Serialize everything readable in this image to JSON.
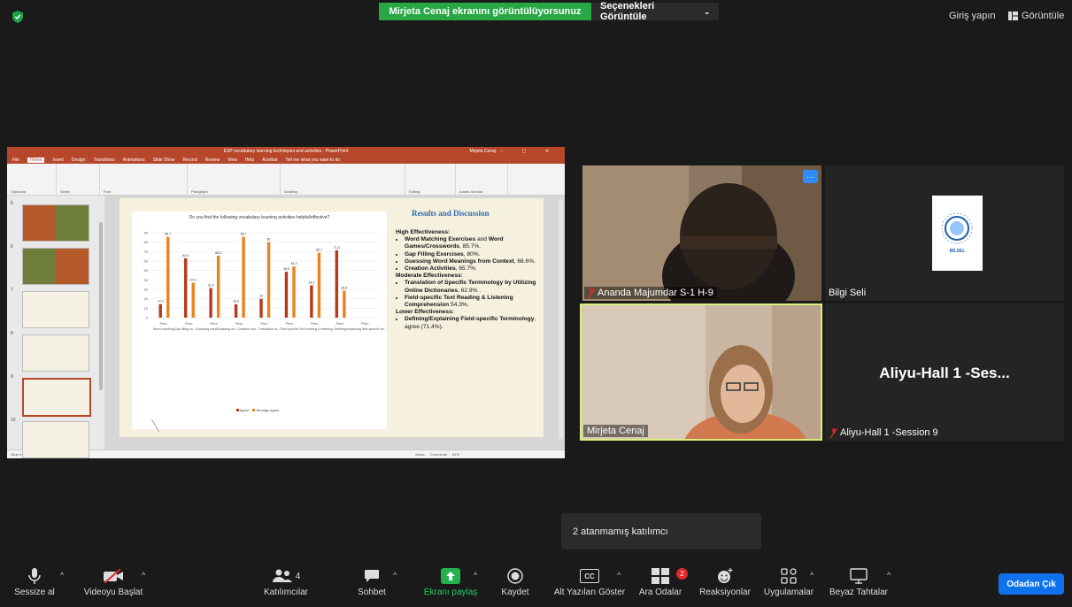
{
  "banner": {
    "sharing_text": "Mirjeta Cenaj ekranını görüntülüyorsunuz",
    "view_options": "Seçenekleri Görüntüle"
  },
  "top_right": {
    "sign_in": "Giriş yapın",
    "view": "Görüntüle"
  },
  "ppt": {
    "title": "ESP vocabulary learning techniques and activities - PowerPoint",
    "user": "Mirjeta Cenaj",
    "tabs": [
      "File",
      "Home",
      "Insert",
      "Design",
      "Transitions",
      "Animations",
      "Slide Show",
      "Record",
      "Review",
      "View",
      "Help",
      "Acrobat",
      "Tell me what you want to do"
    ],
    "ribbon_groups": [
      "Clipboard",
      "Slides",
      "Font",
      "Paragraph",
      "Drawing",
      "Editing",
      "Adobe Acrobat"
    ],
    "thumb_numbers": [
      "5",
      "6",
      "7",
      "8",
      "9",
      "10"
    ],
    "status": [
      "Slide 9 of 11",
      "Accessibility: Investigate",
      "Notes",
      "Comments",
      "61%"
    ]
  },
  "slide": {
    "results_title": "Results and Discussion",
    "high_heading": "High Effectiveness:",
    "high_items": [
      {
        "bold": "Word Matching Exercises",
        "mid": " and ",
        "bold2": "Word Games/Crosswords",
        "rest": ", 85.7%."
      },
      {
        "bold": "Gap Filling Exercises",
        "rest": ", 80%."
      },
      {
        "bold": "Guessing Word Meanings from Context",
        "rest": ", 68.6%."
      },
      {
        "bold": "Creation Activities",
        "rest": ", 65.7%."
      }
    ],
    "moderate_heading": "Moderate Effectiveness:",
    "moderate_items": [
      {
        "bold": "Translation of Specific Terminology by Utilizing Online Dictionaries",
        "rest": ", 62.9% ."
      },
      {
        "bold": "Field-specific Text Reading & Listening Comprehension",
        "rest": " 54.3%."
      }
    ],
    "lower_heading": "Lower Effectiveness:",
    "lower_items": [
      {
        "bold": "Defining/Explaining Field-specific Terminology",
        "rest": ", agree (71.4%)."
      }
    ]
  },
  "chart_data": {
    "type": "bar",
    "title": "Do you find the following vocabulary learning activities helpful/effective?",
    "categories": [
      "Perc.",
      "Perc.",
      "Perc.",
      "Perc.",
      "Perc.",
      "Perc.",
      "Perc.",
      "Perc.",
      "Perc."
    ],
    "ylim": [
      0,
      90
    ],
    "yticks": [
      0,
      10,
      20,
      30,
      40,
      50,
      60,
      70,
      80,
      90
    ],
    "series": [
      {
        "name": "Agree",
        "color": "#b53a1b",
        "values": [
          14.3,
          62.9,
          31.4,
          14.3,
          20,
          48.6,
          34.3,
          71.4,
          null
        ]
      },
      {
        "name": "Strongly agree",
        "color": "#e8841c",
        "values": [
          85.7,
          37.1,
          65.7,
          85.7,
          80,
          54.3,
          68.7,
          28.6,
          null
        ]
      }
    ],
    "data_labels": [
      [
        "14.3",
        "62.9",
        "31.4",
        "14.3",
        "20",
        "48.6",
        "34.3",
        "71.4"
      ],
      [
        "85.7",
        "37.1",
        "65.6",
        "85.7",
        "80",
        "54.3",
        "68.7",
        "28.6"
      ]
    ],
    "category_text_overlap": "Word matchingGap filling ex...Guessing wordGuessing wo...Creation acti...Translation of...Field-specific Text reading & listening..Defining/explaining field-specific ter..."
  },
  "participants": [
    {
      "name": "Ananda Majumdar S-1 H-9",
      "muted": true
    },
    {
      "name": "Bilgi Seli",
      "muted": false,
      "logo_text": "BİLSEL"
    },
    {
      "name": "Mirjeta Cenaj",
      "muted": false
    },
    {
      "name": "Aliyu-Hall 1 -Session 9",
      "muted": true,
      "big_name": "Aliyu-Hall 1 -Ses..."
    }
  ],
  "more_button": "···",
  "popup": {
    "text": "2 atanmamış katılımcı"
  },
  "toolbar": {
    "mute": "Sessize al",
    "video": "Videoyu Başlat",
    "participants": "Katılımcılar",
    "participants_count": "4",
    "chat": "Sohbet",
    "share": "Ekranı paylaş",
    "record": "Kaydet",
    "captions": "Alt Yazıları Göster",
    "captions_icon_text": "CC",
    "breakout": "Ara Odalar",
    "breakout_badge": "2",
    "reactions": "Reaksiyonlar",
    "apps": "Uygulamalar",
    "whiteboards": "Beyaz Tahtalar",
    "leave": "Odadan Çık"
  },
  "colors": {
    "banner_green": "#28a745",
    "leave_blue": "#0e72ed",
    "ppt_red": "#b7472a",
    "active_speaker": "#d8ef7a"
  }
}
